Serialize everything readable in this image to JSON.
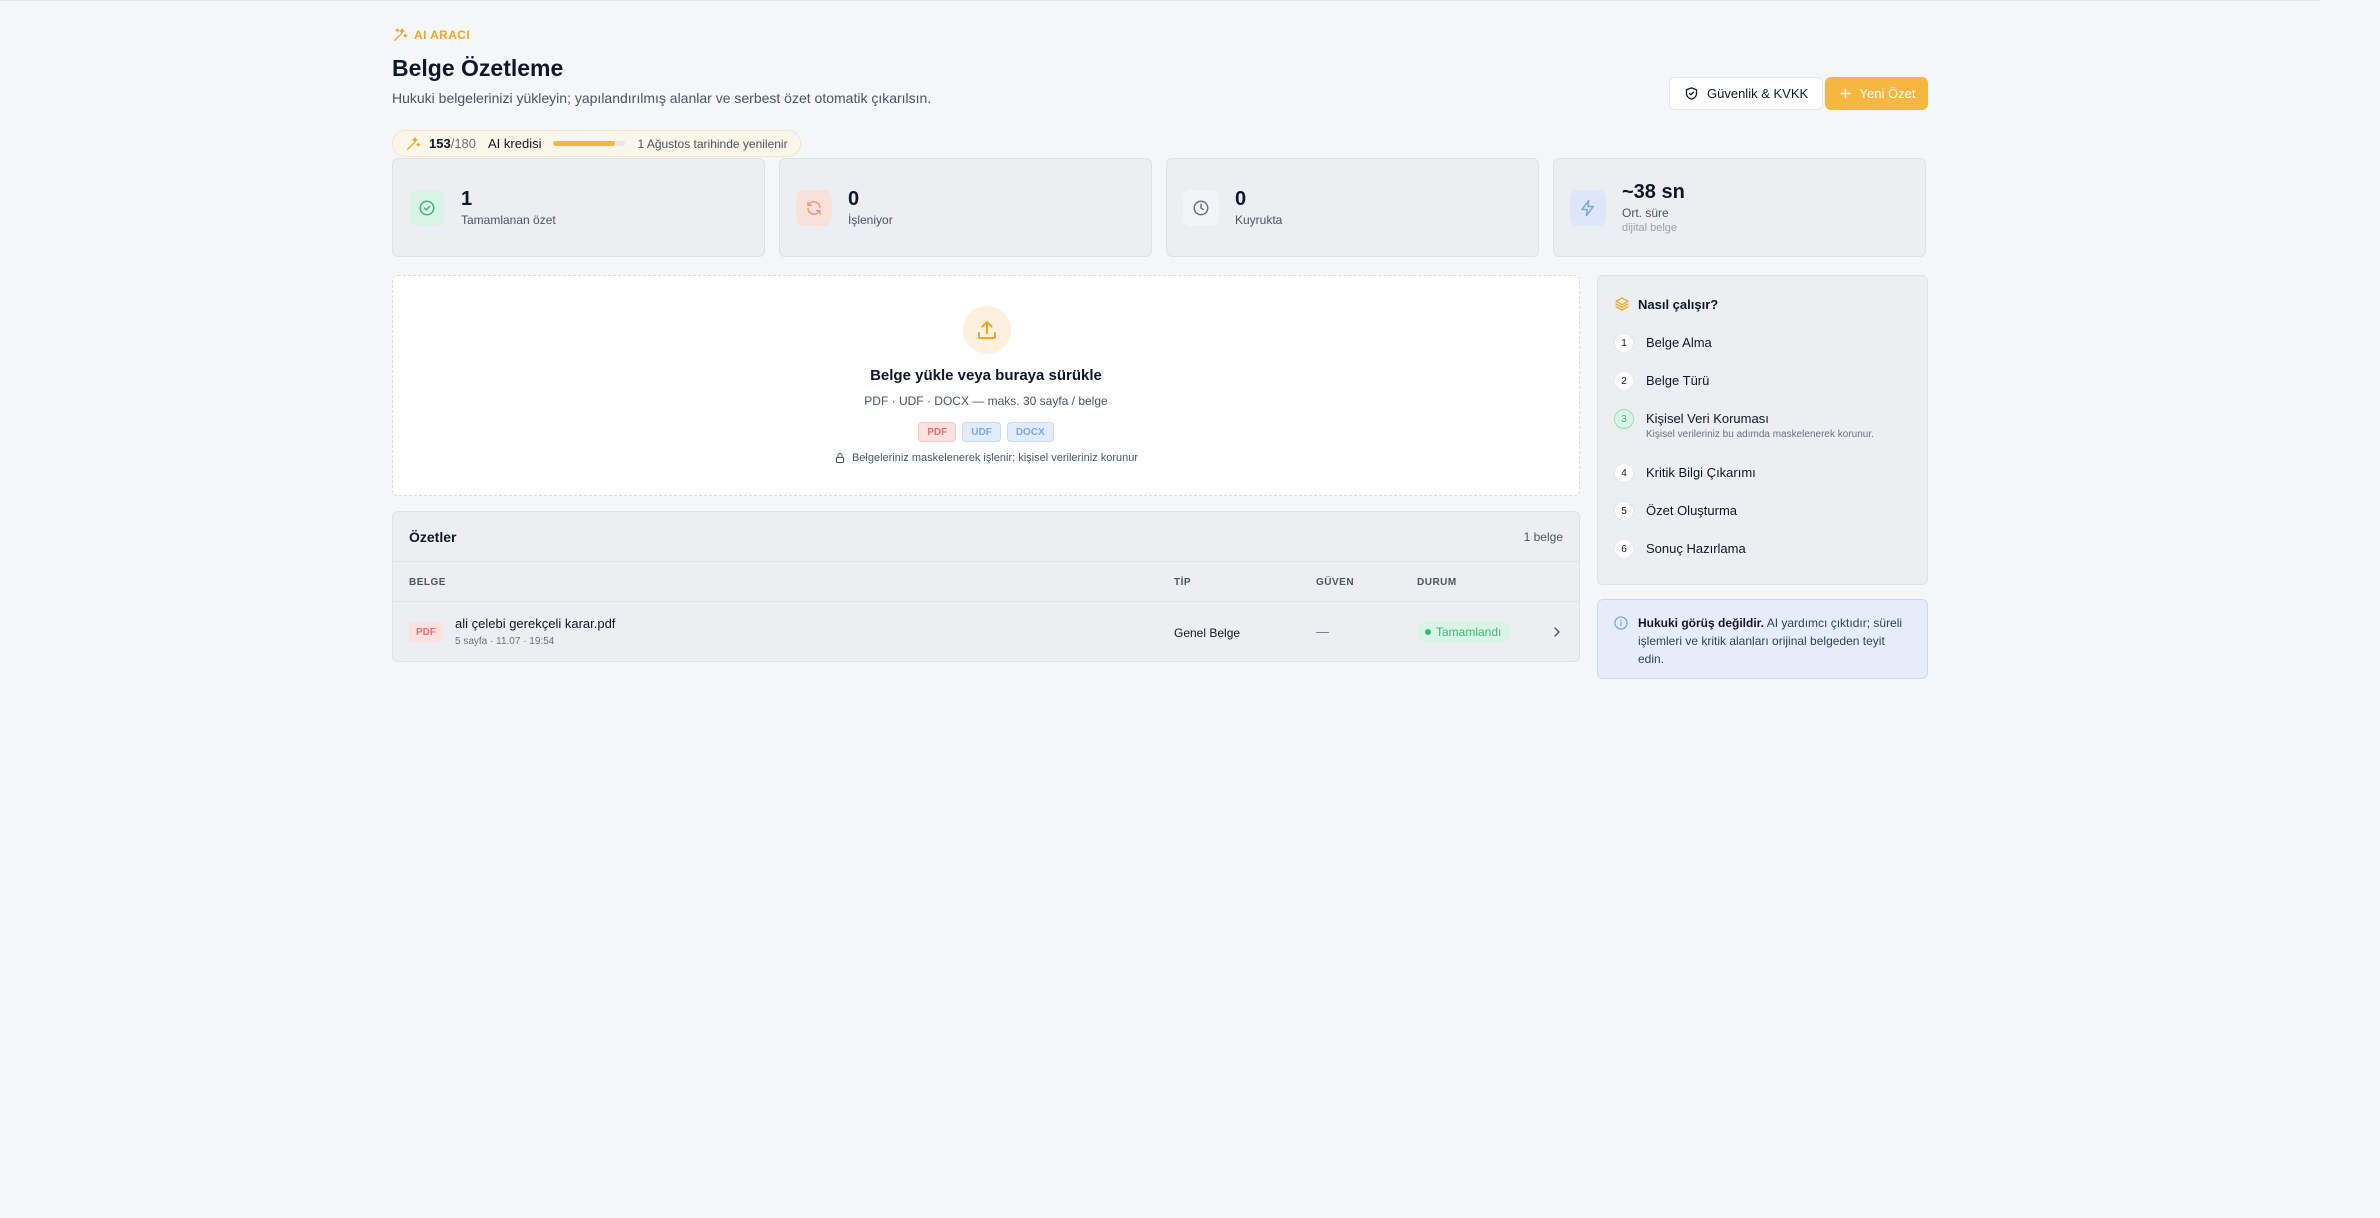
{
  "header": {
    "eyebrow": "AI ARACI",
    "title": "Belge Özetleme",
    "subtitle": "Hukuki belgelerinizi yükleyin; yapılandırılmış alanlar ve serbest özet otomatik çıkarılsın.",
    "security_button": "Güvenlik & KVKK",
    "new_button": "Yeni Özet"
  },
  "credit": {
    "used": "153",
    "max": "/180",
    "label": "AI kredisi",
    "fraction": 0.85,
    "renew": "1 Ağustos tarihinde yenilenir"
  },
  "stats": [
    {
      "value": "1",
      "label": "Tamamlanan özet",
      "sub": "",
      "icon": "check-circle-icon",
      "color": "#3eb57a",
      "bg": "#d9f3e5"
    },
    {
      "value": "0",
      "label": "İşleniyor",
      "sub": "",
      "icon": "refresh-icon",
      "color": "#ef9a7a",
      "bg": "#f9e2d9"
    },
    {
      "value": "0",
      "label": "Kuyrukta",
      "sub": "",
      "icon": "clock-icon",
      "color": "#6b7280",
      "bg": "#f3f4f6"
    },
    {
      "value": "~38 sn",
      "label": "Ort. süre",
      "sub": "dijital belge",
      "icon": "bolt-icon",
      "color": "#7aa6ec",
      "bg": "#dde7f8"
    }
  ],
  "upload": {
    "title": "Belge yükle veya buraya sürükle",
    "formats": "PDF · UDF · DOCX — maks. 30 sayfa / belge",
    "chips": [
      "PDF",
      "UDF",
      "DOCX"
    ],
    "note": "Belgeleriniz maskelenerek işlenir; kişisel verileriniz korunur"
  },
  "table": {
    "title": "Özetler",
    "count": "1 belge",
    "columns": [
      "BELGE",
      "TİP",
      "GÜVEN",
      "DURUM"
    ],
    "rows": [
      {
        "badge": "PDF",
        "name": "ali çelebi gerekçeli karar.pdf",
        "meta": "5 sayfa · 11.07 · 19:54",
        "type": "Genel Belge",
        "confidence": "—",
        "status": "Tamamlandı"
      }
    ]
  },
  "how": {
    "title": "Nasıl çalışır?",
    "steps": [
      {
        "n": "1",
        "title": "Belge Alma",
        "desc": ""
      },
      {
        "n": "2",
        "title": "Belge Türü",
        "desc": ""
      },
      {
        "n": "3",
        "title": "Kişisel Veri Koruması",
        "desc": "Kişisel verileriniz bu adımda maskelenerek korunur."
      },
      {
        "n": "4",
        "title": "Kritik Bilgi Çıkarımı",
        "desc": ""
      },
      {
        "n": "5",
        "title": "Özet Oluşturma",
        "desc": ""
      },
      {
        "n": "6",
        "title": "Sonuç Hazırlama",
        "desc": ""
      }
    ]
  },
  "notice": {
    "bold": "Hukuki görüş değildir.",
    "text": " AI yardımcı çıktıdır; süreli işlemleri ve kritik alanları orijinal belgeden teyit edin."
  },
  "colors": {
    "accent": "#f5b73f",
    "success": "#3eb57a",
    "info": "#7aa6ec"
  }
}
